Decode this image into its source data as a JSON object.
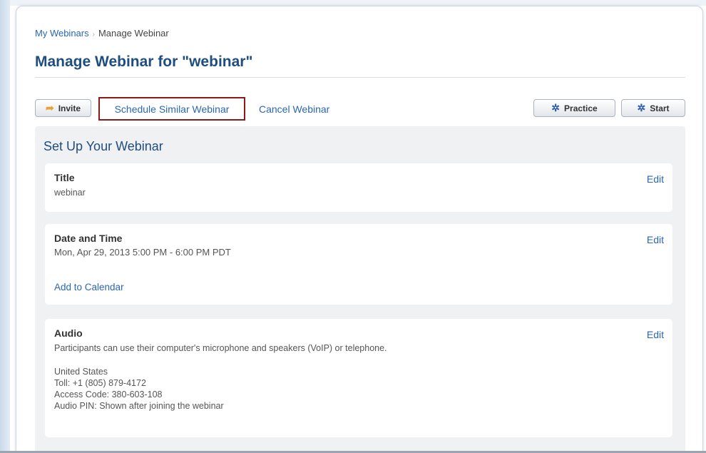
{
  "breadcrumb": {
    "parent": "My Webinars",
    "separator": "›",
    "current": "Manage Webinar"
  },
  "page": {
    "title": "Manage Webinar for \"webinar\""
  },
  "toolbar": {
    "invite_label": "Invite",
    "schedule_similar_label": "Schedule Similar Webinar",
    "cancel_label": "Cancel Webinar",
    "practice_label": "Practice",
    "start_label": "Start"
  },
  "setup": {
    "heading": "Set Up Your Webinar",
    "title_card": {
      "heading": "Title",
      "value": "webinar",
      "edit_label": "Edit"
    },
    "date_card": {
      "heading": "Date and Time",
      "value": "Mon, Apr 29, 2013 5:00 PM - 6:00 PM PDT",
      "add_calendar_label": "Add to Calendar",
      "edit_label": "Edit"
    },
    "audio_card": {
      "heading": "Audio",
      "description": "Participants can use their computer's microphone and speakers (VoIP) or telephone.",
      "country": "United States",
      "toll": "Toll: +1 (805) 879-4172",
      "access_code": "Access Code: 380-603-108",
      "audio_pin": "Audio PIN: Shown after joining the webinar",
      "edit_label": "Edit"
    }
  },
  "icons": {
    "invite": "arrow-icon",
    "practice": "gear-icon",
    "start": "gear-icon"
  },
  "colors": {
    "link": "#2a66b1",
    "title": "#1f4d7f",
    "highlight_border": "#8b1a1a",
    "setup_bg": "#eff1f3"
  }
}
